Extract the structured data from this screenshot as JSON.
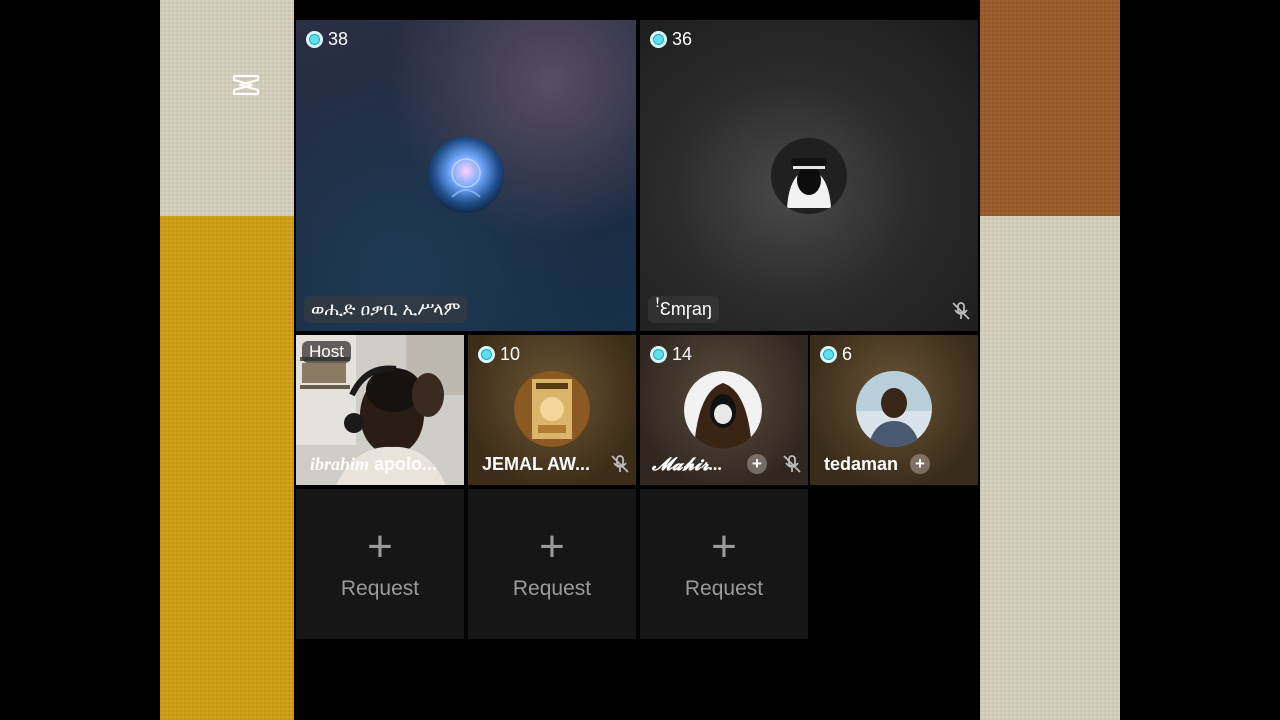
{
  "tiles": {
    "big1": {
      "viewers": "38",
      "name": "ወሒድ ዐቃቢ ኢሥላም"
    },
    "big2": {
      "viewers": "36",
      "name": "ꜝƐmɼaŋ"
    },
    "host": {
      "badge": "Host",
      "name_italic": "ibrahim",
      "name_rest": " apolo..."
    },
    "s2": {
      "viewers": "10",
      "name": "JEMAL AW..."
    },
    "s3": {
      "viewers": "14",
      "name": "𝓜𝓪𝓱𝓲𝓻..."
    },
    "s4": {
      "viewers": "6",
      "name": "tedaman"
    }
  },
  "requests": [
    {
      "label": "Request"
    },
    {
      "label": "Request"
    },
    {
      "label": "Request"
    }
  ],
  "icons": {
    "viewer": "viewer-dot-icon",
    "mute": "mic-muted-icon",
    "add": "add-icon",
    "logo": "capcut-logo-icon"
  },
  "colors": {
    "viewer_dot": "#5ee0f0",
    "request_text": "#9a9a9a"
  }
}
